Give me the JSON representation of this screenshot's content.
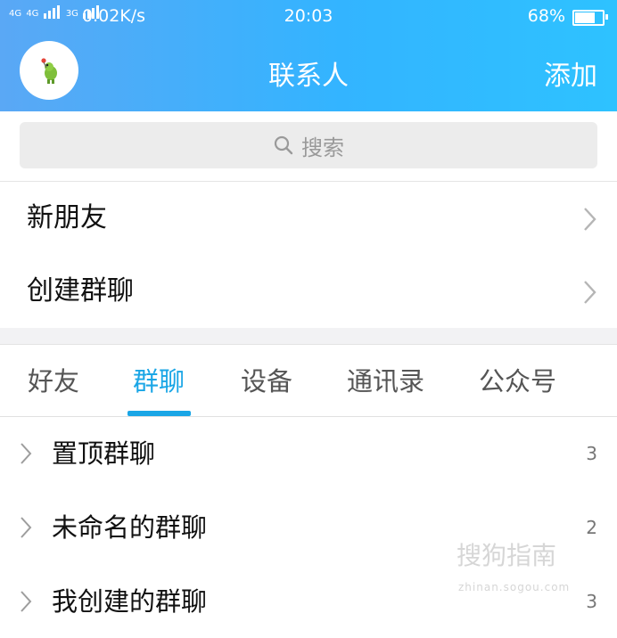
{
  "status_bar": {
    "network1": "4G",
    "network2": "4G",
    "network3": "3G",
    "speed": "0.02K/s",
    "time": "20:03",
    "battery": "68%",
    "battery_level": 0.68
  },
  "header": {
    "title": "联系人",
    "add_label": "添加"
  },
  "search": {
    "placeholder": "搜索"
  },
  "menu": [
    {
      "label": "新朋友"
    },
    {
      "label": "创建群聊"
    }
  ],
  "tabs": [
    {
      "label": "好友",
      "active": false
    },
    {
      "label": "群聊",
      "active": true
    },
    {
      "label": "设备",
      "active": false
    },
    {
      "label": "通讯录",
      "active": false
    },
    {
      "label": "公众号",
      "active": false
    }
  ],
  "groups": [
    {
      "name": "置顶群聊",
      "count": "3"
    },
    {
      "name": "未命名的群聊",
      "count": "2"
    },
    {
      "name": "我创建的群聊",
      "count": "3"
    }
  ],
  "watermark": {
    "logo": "搜狗指南",
    "url": "zhinan.sogou.com"
  },
  "colors": {
    "header_start": "#5aa8f5",
    "header_end": "#2ec2ff",
    "accent": "#1aa6e6"
  }
}
